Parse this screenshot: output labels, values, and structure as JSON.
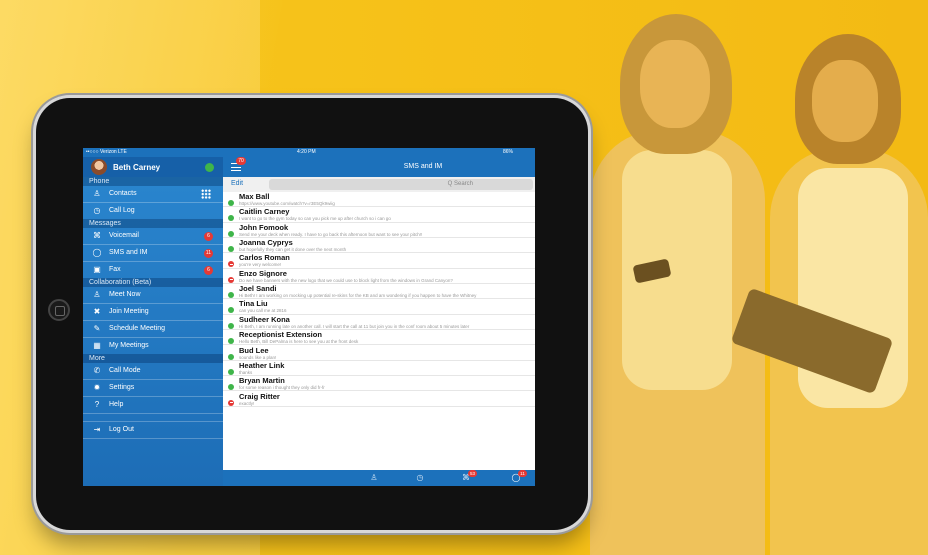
{
  "status_bar": {
    "carrier": "••○○○ Verizon  LTE",
    "time": "4:20 PM",
    "battery": "86%"
  },
  "sidebar": {
    "user_name": "Beth Carney",
    "sections": {
      "phone": "Phone",
      "messages": "Messages",
      "collaboration": "Collaboration (Beta)",
      "more": "More"
    },
    "items": {
      "contacts": "Contacts",
      "call_log": "Call Log",
      "voicemail": "Voicemail",
      "voicemail_badge": "6",
      "sms": "SMS and IM",
      "sms_badge": "11",
      "fax": "Fax",
      "fax_badge": "6",
      "meet_now": "Meet Now",
      "join_meeting": "Join Meeting",
      "schedule_meeting": "Schedule Meeting",
      "my_meetings": "My Meetings",
      "call_mode": "Call Mode",
      "settings": "Settings",
      "help": "Help",
      "log_out": "Log Out"
    }
  },
  "main": {
    "title": "SMS and IM",
    "menu_badge": "70",
    "edit_label": "Edit",
    "search_placeholder": "Q Search",
    "conversations": [
      {
        "name": "Max Ball",
        "message": "https://www.youtube.com/watch?v=r3E5Qk9wiig",
        "status": "online"
      },
      {
        "name": "Caitlin Carney",
        "message": "I want to go to the gym today so can you pick me up after church so i can go",
        "status": "online"
      },
      {
        "name": "John Fomook",
        "message": "Send me your deck when ready. I have to go back this afternoon but want to see your pitch!!",
        "status": "online"
      },
      {
        "name": "Joanna Cyprys",
        "message": "but hopefully they can get it done over the next month",
        "status": "online"
      },
      {
        "name": "Carlos Roman",
        "message": "you're very welcome!",
        "status": "dnd"
      },
      {
        "name": "Enzo Signore",
        "message": "Do we have banners with the new logo that we could use to block light from the windows in Grand Canyon?",
        "status": "dnd"
      },
      {
        "name": "Joel Sandi",
        "message": "Hi Beth! I am working on mocking up potential re-skins for the KB and am wondering if you happen to have the Whitney",
        "status": "online"
      },
      {
        "name": "Tina Liu",
        "message": "can you call me at 2816",
        "status": "online"
      },
      {
        "name": "Sudheer Kona",
        "message": "Hi Beth, I am running late on another call.  I will start the call at 11 but join you in the conf room about 5 minutes later",
        "status": "online"
      },
      {
        "name": "Receptionist Extension",
        "message": "Hello Beth, Bill DePalma is here to see you at the front desk",
        "status": "online"
      },
      {
        "name": "Bud Lee",
        "message": "sounds like a plan!",
        "status": "online"
      },
      {
        "name": "Heather Link",
        "message": "thanks",
        "status": "online"
      },
      {
        "name": "Bryan Martin",
        "message": "for some reason i thought they only did fr-fr",
        "status": "online"
      },
      {
        "name": "Craig Ritter",
        "message": "exactly!",
        "status": "dnd"
      }
    ],
    "tabbar": {
      "voicemail_badge": "53",
      "chat_badge": "11"
    }
  },
  "colors": {
    "accent": "#1c71bb",
    "background": "#f7c51e",
    "badge": "#e53935",
    "online": "#3fb54a"
  }
}
